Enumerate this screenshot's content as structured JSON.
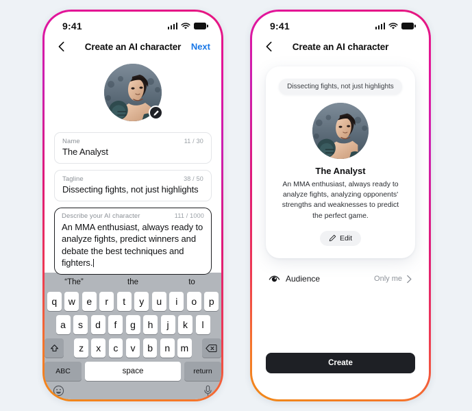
{
  "background_color": "#eef2f6",
  "frame_gradient": [
    "#e6177e",
    "#cc1fb0",
    "#ee3a52",
    "#f08a18"
  ],
  "accent_blue": "#1877e6",
  "dark_button": "#1e2025",
  "status_bar": {
    "time": "9:41",
    "signal_icon": "cellular-bars-icon",
    "wifi_icon": "wifi-icon",
    "battery_icon": "battery-full-icon"
  },
  "left_phone": {
    "nav": {
      "back_icon": "chevron-left-icon",
      "title": "Create an AI character",
      "next_label": "Next"
    },
    "avatar": {
      "name": "character-avatar",
      "edit_badge_icon": "pencil-icon"
    },
    "fields": [
      {
        "key": "name",
        "label": "Name",
        "counter": "11 / 30",
        "value": "The Analyst",
        "focused": false
      },
      {
        "key": "tagline",
        "label": "Tagline",
        "counter": "38 / 50",
        "value": "Dissecting fights, not just highlights",
        "focused": false
      },
      {
        "key": "description",
        "label": "Describe your AI character",
        "counter": "111 / 1000",
        "value": "An MMA enthusiast, always ready to analyze fights, predict winners and debate the best techniques and fighters.",
        "focused": true
      }
    ],
    "keyboard": {
      "suggestions": [
        "“The”",
        "the",
        "to"
      ],
      "row1": [
        "q",
        "w",
        "e",
        "r",
        "t",
        "y",
        "u",
        "i",
        "o",
        "p"
      ],
      "row2": [
        "a",
        "s",
        "d",
        "f",
        "g",
        "h",
        "j",
        "k",
        "l"
      ],
      "row3": [
        "z",
        "x",
        "c",
        "v",
        "b",
        "n",
        "m"
      ],
      "shift_icon": "shift-arrow-icon",
      "backspace_icon": "backspace-icon",
      "abc_label": "ABC",
      "space_label": "space",
      "return_label": "return",
      "emoji_icon": "emoji-smiley-icon",
      "mic_icon": "microphone-icon"
    }
  },
  "right_phone": {
    "nav": {
      "back_icon": "chevron-left-icon",
      "title": "Create an AI character"
    },
    "card": {
      "tagline_bubble": "Dissecting fights, not just highlights",
      "avatar_name": "character-avatar",
      "name": "The Analyst",
      "description": "An MMA enthusiast, always ready to analyze fights, analyzing opponents' strengths and weaknesses to predict the perfect game.",
      "edit_label": "Edit",
      "edit_icon": "pencil-icon"
    },
    "audience": {
      "icon": "eye-icon",
      "label": "Audience",
      "value": "Only me",
      "chevron_icon": "chevron-right-icon"
    },
    "create_label": "Create"
  }
}
